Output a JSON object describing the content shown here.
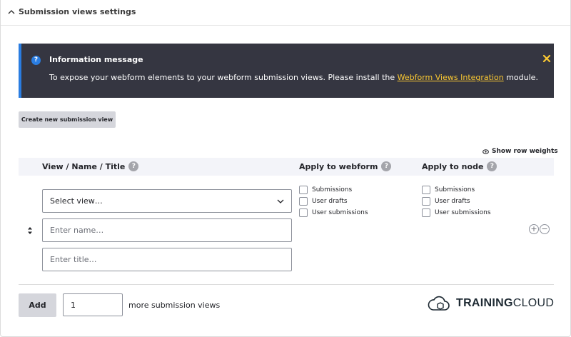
{
  "section": {
    "title": "Submission views settings"
  },
  "message": {
    "title": "Information message",
    "text_before": "To expose your webform elements to your webform submission views. Please install the ",
    "link_text": "Webform Views Integration",
    "text_after": " module."
  },
  "buttons": {
    "create_view": "Create new submission view",
    "add": "Add"
  },
  "weights": {
    "label": "Show row weights"
  },
  "table": {
    "columns": [
      "View / Name / Title",
      "Apply to webform",
      "Apply to node"
    ]
  },
  "row": {
    "view_select_value": "Select view…",
    "name_placeholder": "Enter name…",
    "title_placeholder": "Enter title…",
    "webform_options": [
      "Submissions",
      "User drafts",
      "User submissions"
    ],
    "node_options": [
      "Submissions",
      "User drafts",
      "User submissions"
    ]
  },
  "footer": {
    "count_value": "1",
    "more_label": "more submission views"
  },
  "logo": {
    "bold": "TRAINING",
    "light": "CLOUD"
  },
  "colors": {
    "message_bg": "#353641",
    "accent": "#2a7de1",
    "link": "#fbc932",
    "close": "#fbc932"
  }
}
